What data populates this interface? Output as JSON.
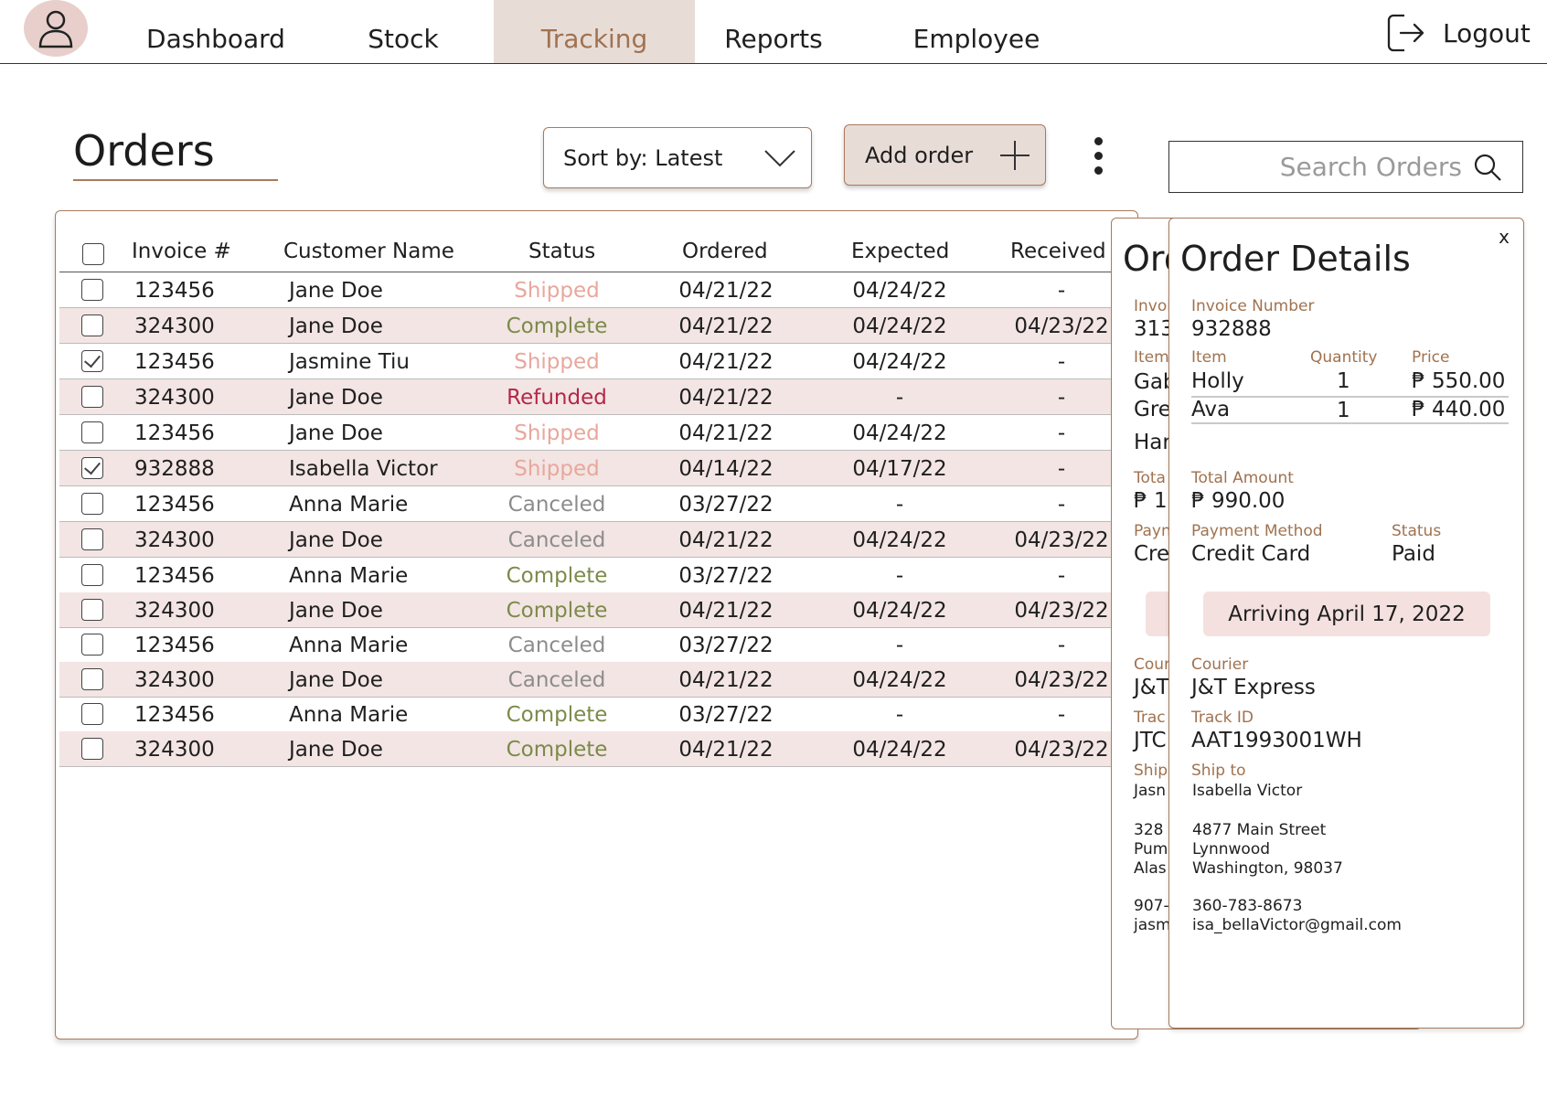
{
  "nav": {
    "tabs": [
      {
        "label": "Dashboard"
      },
      {
        "label": "Stock"
      },
      {
        "label": "Tracking"
      },
      {
        "label": "Reports"
      },
      {
        "label": "Employee"
      }
    ],
    "active_tab": "Tracking",
    "logout_label": "Logout"
  },
  "header": {
    "title": "Orders",
    "sort_label": "Sort by: Latest",
    "add_order_label": "Add order",
    "search_placeholder": "Search Orders"
  },
  "table": {
    "columns": [
      "Invoice #",
      "Customer Name",
      "Status",
      "Ordered",
      "Expected",
      "Received"
    ],
    "rows": [
      {
        "invoice": "123456",
        "customer": "Jane Doe",
        "status": "Shipped",
        "ordered": "04/21/22",
        "expected": "04/24/22",
        "received": "-",
        "checked": false
      },
      {
        "invoice": "324300",
        "customer": "Jane Doe",
        "status": "Complete",
        "ordered": "04/21/22",
        "expected": "04/24/22",
        "received": "04/23/22",
        "checked": false
      },
      {
        "invoice": "123456",
        "customer": "Jasmine Tiu",
        "status": "Shipped",
        "ordered": "04/21/22",
        "expected": "04/24/22",
        "received": "-",
        "checked": true
      },
      {
        "invoice": "324300",
        "customer": "Jane Doe",
        "status": "Refunded",
        "ordered": "04/21/22",
        "expected": "-",
        "received": "-",
        "checked": false
      },
      {
        "invoice": "123456",
        "customer": "Jane Doe",
        "status": "Shipped",
        "ordered": "04/21/22",
        "expected": "04/24/22",
        "received": "-",
        "checked": false
      },
      {
        "invoice": "932888",
        "customer": "Isabella Victor",
        "status": "Shipped",
        "ordered": "04/14/22",
        "expected": "04/17/22",
        "received": "-",
        "checked": true
      },
      {
        "invoice": "123456",
        "customer": "Anna Marie",
        "status": "Canceled",
        "ordered": "03/27/22",
        "expected": "-",
        "received": "-",
        "checked": false
      },
      {
        "invoice": "324300",
        "customer": "Jane Doe",
        "status": "Canceled",
        "ordered": "04/21/22",
        "expected": "04/24/22",
        "received": "04/23/22",
        "checked": false
      },
      {
        "invoice": "123456",
        "customer": "Anna Marie",
        "status": "Complete",
        "ordered": "03/27/22",
        "expected": "-",
        "received": "-",
        "checked": false
      },
      {
        "invoice": "324300",
        "customer": "Jane Doe",
        "status": "Complete",
        "ordered": "04/21/22",
        "expected": "04/24/22",
        "received": "04/23/22",
        "checked": false
      },
      {
        "invoice": "123456",
        "customer": "Anna Marie",
        "status": "Canceled",
        "ordered": "03/27/22",
        "expected": "-",
        "received": "-",
        "checked": false
      },
      {
        "invoice": "324300",
        "customer": "Jane Doe",
        "status": "Canceled",
        "ordered": "04/21/22",
        "expected": "04/24/22",
        "received": "04/23/22",
        "checked": false
      },
      {
        "invoice": "123456",
        "customer": "Anna Marie",
        "status": "Complete",
        "ordered": "03/27/22",
        "expected": "-",
        "received": "-",
        "checked": false
      },
      {
        "invoice": "324300",
        "customer": "Jane Doe",
        "status": "Complete",
        "ordered": "04/21/22",
        "expected": "04/24/22",
        "received": "04/23/22",
        "checked": false
      }
    ]
  },
  "status_colors": {
    "Shipped": "#e8a79c",
    "Complete": "#7c8a4a",
    "Refunded": "#b5264a",
    "Canceled": "#8c8c8c"
  },
  "back_panel": {
    "title": "Ord",
    "invoice_label": "Invoi",
    "invoice_value": "313",
    "item_label": "Item",
    "items": [
      "Gab",
      "Gre",
      "Har"
    ],
    "total_label": "Tota",
    "total_value": "₱ 1",
    "payment_label": "Payn",
    "payment_value": "Cre",
    "courier_label": "Cour",
    "courier_value": "J&T",
    "track_label": "Trac",
    "track_value": "JTC",
    "ship_label": "Ship",
    "ship_name": "Jasn",
    "address": [
      "328",
      "Pum",
      "Alas"
    ],
    "phone": "907-",
    "email": "jasm"
  },
  "detail": {
    "title": "Order Details",
    "close_label": "x",
    "invoice_label": "Invoice Number",
    "invoice_value": "932888",
    "item_header": "Item",
    "quantity_header": "Quantity",
    "price_header": "Price",
    "items": [
      {
        "name": "Holly",
        "quantity": "1",
        "price": "₱ 550.00"
      },
      {
        "name": "Ava",
        "quantity": "1",
        "price": "₱ 440.00"
      }
    ],
    "total_label": "Total Amount",
    "total_value": "₱ 990.00",
    "payment_label": "Payment Method",
    "payment_value": "Credit Card",
    "status_label": "Status",
    "status_value": "Paid",
    "arriving": "Arriving April 17, 2022",
    "courier_label": "Courier",
    "courier_value": "J&T Express",
    "track_label": "Track ID",
    "track_value": "AAT1993001WH",
    "ship_label": "Ship to",
    "ship_name": "Isabella Victor",
    "address": [
      "4877 Main Street",
      "Lynnwood",
      "Washington, 98037"
    ],
    "phone": "360-783-8673",
    "email": "isa_bellaVictor@gmail.com"
  },
  "accent_colors": {
    "brand": "#a87a5e",
    "active_tab_bg": "#e8dcd7",
    "row_alt_bg": "#f2e5e3",
    "avatar_bg": "#e8cfcc",
    "arriving_bg": "#f4e1df"
  },
  "icons": {
    "avatar": "user-icon",
    "logout": "logout-icon",
    "sort": "chevron-down-icon",
    "add": "plus-icon",
    "more": "kebab-menu-icon",
    "search": "search-icon"
  }
}
